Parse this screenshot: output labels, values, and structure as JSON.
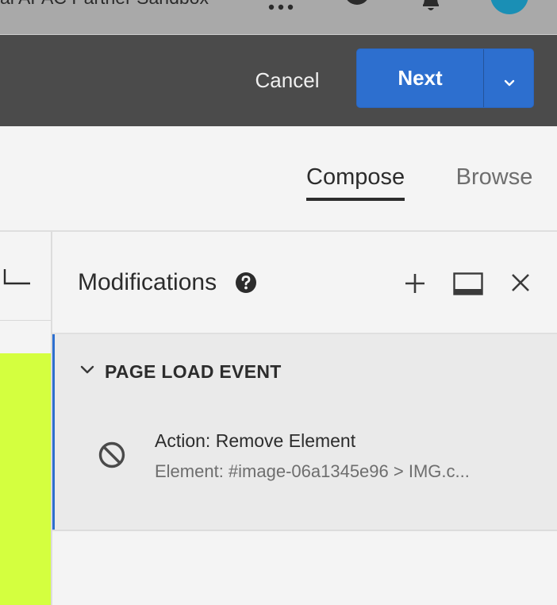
{
  "topbar": {
    "org_name": "al APAC Partner Sandbox",
    "icons": [
      "apps-grid-icon",
      "help-circle-icon",
      "bell-icon",
      "avatar"
    ],
    "avatar_color": "#1a8fb5"
  },
  "actions": {
    "cancel_label": "Cancel",
    "next_label": "Next",
    "next_menu_icon": "chevron-down-icon",
    "primary_color": "#2d6fcf"
  },
  "tabs": [
    {
      "label": "Compose",
      "selected": true
    },
    {
      "label": "Browse",
      "selected": false
    }
  ],
  "canvas": {
    "image_color": "#d4ff3f"
  },
  "panel": {
    "title": "Modifications",
    "icons": [
      "help-icon",
      "add-icon",
      "layout-icon",
      "close-icon"
    ],
    "event": {
      "title": "PAGE LOAD EVENT",
      "expanded": true,
      "items": [
        {
          "icon": "remove-icon",
          "action": "Action: Remove Element",
          "element": "Element: #image-06a1345e96 > IMG.c..."
        }
      ]
    }
  }
}
